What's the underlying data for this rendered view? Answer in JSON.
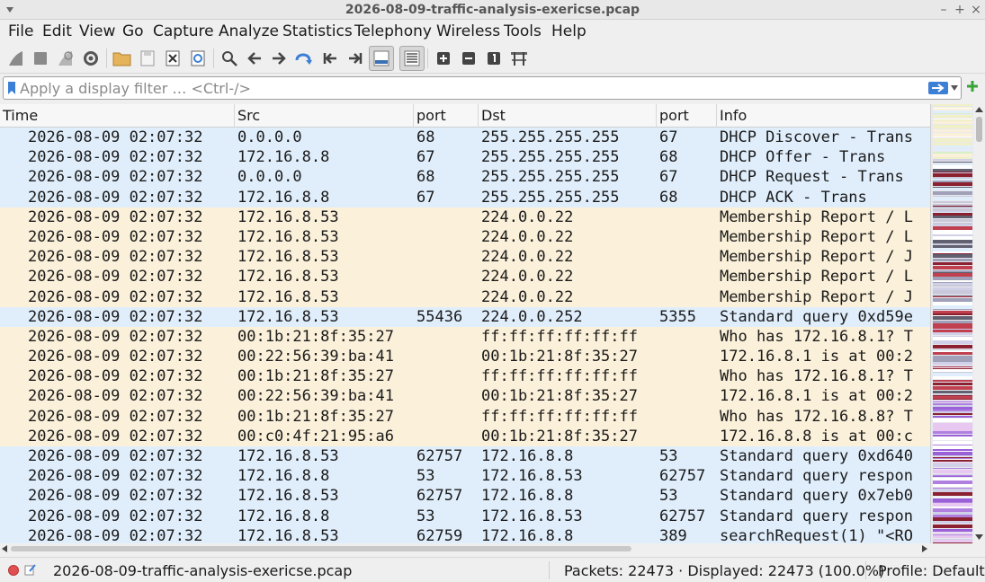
{
  "window": {
    "title": "2026-08-09-traffic-analysis-exericse.pcap",
    "controls": [
      "–",
      "+",
      "×"
    ]
  },
  "menu": [
    "File",
    "Edit",
    "View",
    "Go",
    "Capture",
    "Analyze",
    "Statistics",
    "Telephony",
    "Wireless",
    "Tools",
    "Help"
  ],
  "toolbar": {
    "icons": [
      "shark-fin-start-icon",
      "stop-icon",
      "restart-icon",
      "capture-options-icon",
      "open-file-icon",
      "save-file-icon",
      "close-file-icon",
      "reload-icon",
      "find-icon",
      "go-back-icon",
      "go-forward-icon",
      "go-to-packet-icon",
      "first-packet-icon",
      "last-packet-icon",
      "autoscroll-icon",
      "colorize-icon",
      "zoom-in-icon",
      "zoom-out-icon",
      "normal-size-icon",
      "resize-columns-icon"
    ]
  },
  "filter": {
    "placeholder": "Apply a display filter … <Ctrl-/>",
    "value": ""
  },
  "columns": {
    "time": "Time",
    "src": "Src",
    "sport": "port",
    "dst": "Dst",
    "dport": "port",
    "info": "Info"
  },
  "rows": [
    {
      "time": "2026-08-09 02:07:32",
      "src": "0.0.0.0",
      "sport": "68",
      "dst": "255.255.255.255",
      "dport": "67",
      "info": "DHCP Discover - Trans",
      "color": "blue"
    },
    {
      "time": "2026-08-09 02:07:32",
      "src": "172.16.8.8",
      "sport": "67",
      "dst": "255.255.255.255",
      "dport": "68",
      "info": "DHCP Offer    - Trans",
      "color": "blue"
    },
    {
      "time": "2026-08-09 02:07:32",
      "src": "0.0.0.0",
      "sport": "68",
      "dst": "255.255.255.255",
      "dport": "67",
      "info": "DHCP Request  - Trans",
      "color": "blue"
    },
    {
      "time": "2026-08-09 02:07:32",
      "src": "172.16.8.8",
      "sport": "67",
      "dst": "255.255.255.255",
      "dport": "68",
      "info": "DHCP ACK      - Trans",
      "color": "blue"
    },
    {
      "time": "2026-08-09 02:07:32",
      "src": "172.16.8.53",
      "sport": "",
      "dst": "224.0.0.22",
      "dport": "",
      "info": "Membership Report / L",
      "color": "tan"
    },
    {
      "time": "2026-08-09 02:07:32",
      "src": "172.16.8.53",
      "sport": "",
      "dst": "224.0.0.22",
      "dport": "",
      "info": "Membership Report / L",
      "color": "tan"
    },
    {
      "time": "2026-08-09 02:07:32",
      "src": "172.16.8.53",
      "sport": "",
      "dst": "224.0.0.22",
      "dport": "",
      "info": "Membership Report / J",
      "color": "tan"
    },
    {
      "time": "2026-08-09 02:07:32",
      "src": "172.16.8.53",
      "sport": "",
      "dst": "224.0.0.22",
      "dport": "",
      "info": "Membership Report / L",
      "color": "tan"
    },
    {
      "time": "2026-08-09 02:07:32",
      "src": "172.16.8.53",
      "sport": "",
      "dst": "224.0.0.22",
      "dport": "",
      "info": "Membership Report / J",
      "color": "tan"
    },
    {
      "time": "2026-08-09 02:07:32",
      "src": "172.16.8.53",
      "sport": "55436",
      "dst": "224.0.0.252",
      "dport": "5355",
      "info": "Standard query 0xd59e",
      "color": "blue"
    },
    {
      "time": "2026-08-09 02:07:32",
      "src": "00:1b:21:8f:35:27",
      "sport": "",
      "dst": "ff:ff:ff:ff:ff:ff",
      "dport": "",
      "info": "Who has 172.16.8.1? T",
      "color": "tan"
    },
    {
      "time": "2026-08-09 02:07:32",
      "src": "00:22:56:39:ba:41",
      "sport": "",
      "dst": "00:1b:21:8f:35:27",
      "dport": "",
      "info": "172.16.8.1 is at 00:2",
      "color": "tan"
    },
    {
      "time": "2026-08-09 02:07:32",
      "src": "00:1b:21:8f:35:27",
      "sport": "",
      "dst": "ff:ff:ff:ff:ff:ff",
      "dport": "",
      "info": "Who has 172.16.8.1? T",
      "color": "tan"
    },
    {
      "time": "2026-08-09 02:07:32",
      "src": "00:22:56:39:ba:41",
      "sport": "",
      "dst": "00:1b:21:8f:35:27",
      "dport": "",
      "info": "172.16.8.1 is at 00:2",
      "color": "tan"
    },
    {
      "time": "2026-08-09 02:07:32",
      "src": "00:1b:21:8f:35:27",
      "sport": "",
      "dst": "ff:ff:ff:ff:ff:ff",
      "dport": "",
      "info": "Who has 172.16.8.8? T",
      "color": "tan"
    },
    {
      "time": "2026-08-09 02:07:32",
      "src": "00:c0:4f:21:95:a6",
      "sport": "",
      "dst": "00:1b:21:8f:35:27",
      "dport": "",
      "info": "172.16.8.8 is at 00:c",
      "color": "tan"
    },
    {
      "time": "2026-08-09 02:07:32",
      "src": "172.16.8.53",
      "sport": "62757",
      "dst": "172.16.8.8",
      "dport": "53",
      "info": "Standard query 0xd640",
      "color": "blue"
    },
    {
      "time": "2026-08-09 02:07:32",
      "src": "172.16.8.8",
      "sport": "53",
      "dst": "172.16.8.53",
      "dport": "62757",
      "info": "Standard query respon",
      "color": "blue"
    },
    {
      "time": "2026-08-09 02:07:32",
      "src": "172.16.8.53",
      "sport": "62757",
      "dst": "172.16.8.8",
      "dport": "53",
      "info": "Standard query 0x7eb0",
      "color": "blue"
    },
    {
      "time": "2026-08-09 02:07:32",
      "src": "172.16.8.8",
      "sport": "53",
      "dst": "172.16.8.53",
      "dport": "62757",
      "info": "Standard query respon",
      "color": "blue"
    },
    {
      "time": "2026-08-09 02:07:32",
      "src": "172.16.8.53",
      "sport": "62759",
      "dst": "172.16.8.8",
      "dport": "389",
      "info": "searchRequest(1) \"<RO",
      "color": "blue"
    }
  ],
  "status": {
    "file": "2026-08-09-traffic-analysis-exericse.pcap",
    "packets": "Packets: 22473 · Displayed: 22473 (100.0%)",
    "profile": "Profile: Default"
  },
  "colors": {
    "row_blue": "#e0eefc",
    "row_tan": "#fbf0d9",
    "accent_blue": "#3b7fd6"
  }
}
